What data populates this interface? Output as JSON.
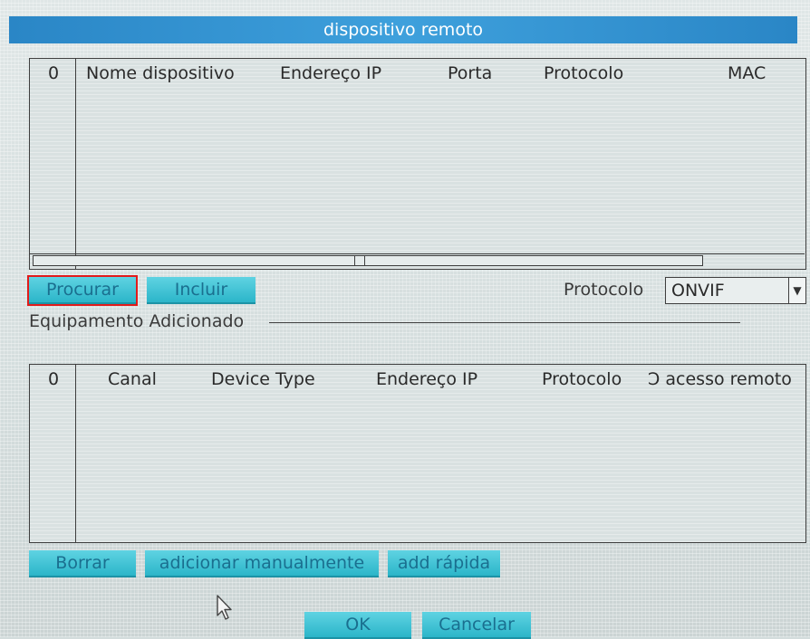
{
  "dialog": {
    "title": "dispositivo remoto"
  },
  "search_table": {
    "columns": [
      "0",
      "Nome dispositivo",
      "Endereço IP",
      "Porta",
      "Protocolo",
      "MAC"
    ],
    "rows": []
  },
  "search_controls": {
    "search_button": "Procurar",
    "add_button": "Incluir",
    "protocol_label": "Protocolo",
    "protocol_value": "ONVIF"
  },
  "added_section": {
    "title": "Equipamento Adicionado"
  },
  "added_table": {
    "columns": [
      "0",
      "Canal",
      "Device Type",
      "Endereço IP",
      "Protocolo",
      "Ɔ acesso remoto"
    ],
    "rows": []
  },
  "bottom_actions": {
    "delete_button": "Borrar",
    "manual_add_button": "adicionar manualmente",
    "quick_add_button": "add rápida"
  },
  "footer": {
    "ok_button": "OK",
    "cancel_button": "Cancelar"
  },
  "colors": {
    "title_bar": "#2a86c6",
    "button_fill": "#2bb5c9",
    "highlight_border": "#e21b1b"
  },
  "icons": {
    "mouse_cursor": "arrow-cursor-icon",
    "dropdown": "chevron-down-icon"
  }
}
